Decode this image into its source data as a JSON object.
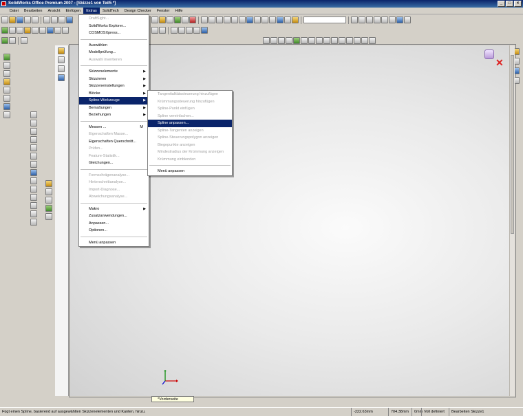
{
  "window": {
    "title": "SolidWorks Office Premium 2007 - [Skizze1 von Teil5 *]",
    "controls": [
      "_",
      "□",
      "×"
    ]
  },
  "menubar": {
    "items": [
      "Datei",
      "Bearbeiten",
      "Ansicht",
      "Einfügen",
      "Extras",
      "SolidTech",
      "Design Checker",
      "Fenster",
      "Hilfe"
    ],
    "active": "Extras"
  },
  "extras_menu": {
    "items": [
      {
        "label": "DraftSight...",
        "disabled": true
      },
      {
        "label": "SolidWorks Explorer..."
      },
      {
        "label": "COSMOSXpress..."
      },
      {
        "sep": true
      },
      {
        "label": "Auswählen"
      },
      {
        "label": "Modellprüfung..."
      },
      {
        "label": "Auswahl invertieren",
        "disabled": true
      },
      {
        "sep": true
      },
      {
        "label": "Skizzenelemente",
        "submenu": true
      },
      {
        "label": "Skizzieren",
        "submenu": true
      },
      {
        "label": "Skizzeneinstellungen",
        "submenu": true
      },
      {
        "label": "Blöcke",
        "submenu": true
      },
      {
        "label": "Spline-Werkzeuge",
        "submenu": true,
        "highlighted": true
      },
      {
        "label": "Bemaßungen",
        "submenu": true
      },
      {
        "label": "Beziehungen",
        "submenu": true
      },
      {
        "sep": true
      },
      {
        "label": "Messen ...",
        "shortcut": "M"
      },
      {
        "label": "Eigenschaften Masse...",
        "disabled": true
      },
      {
        "label": "Eigenschaften Querschnitt..."
      },
      {
        "label": "Prüfen...",
        "disabled": true
      },
      {
        "label": "Feature-Statistik...",
        "disabled": true
      },
      {
        "label": "Gleichungen..."
      },
      {
        "sep": true
      },
      {
        "label": "Formschrägenanalyse...",
        "disabled": true
      },
      {
        "label": "Hinterschnittanalyse...",
        "disabled": true
      },
      {
        "label": "Import-Diagnose...",
        "disabled": true
      },
      {
        "label": "Abweichungsanalyse...",
        "disabled": true
      },
      {
        "sep": true
      },
      {
        "label": "Makro",
        "submenu": true
      },
      {
        "label": "Zusatzanwendungen..."
      },
      {
        "label": "Anpassen..."
      },
      {
        "label": "Optionen..."
      },
      {
        "sep": true
      },
      {
        "label": "Menü anpassen"
      }
    ]
  },
  "spline_submenu": {
    "items": [
      {
        "label": "Tangentialitätssteuerung hinzufügen",
        "disabled": true
      },
      {
        "label": "Krümmungssteuerung hinzufügen",
        "disabled": true
      },
      {
        "label": "Spline-Punkt einfügen",
        "disabled": true
      },
      {
        "label": "Spline vereinfachen...",
        "disabled": true
      },
      {
        "label": "Spline anpassen...",
        "highlighted": true
      },
      {
        "label": "Spline-Tangenten anzeigen",
        "disabled": true
      },
      {
        "label": "Spline-Steuerungspolygon anzeigen",
        "disabled": true
      },
      {
        "label": "Biegepunkte anzeigen",
        "disabled": true
      },
      {
        "label": "Mindestradius der Krümmung anzeigen",
        "disabled": true
      },
      {
        "label": "Krümmung einblenden",
        "disabled": true
      },
      {
        "sep": true
      },
      {
        "label": "Menü anpassen"
      }
    ]
  },
  "viewport": {
    "view_tab": "*Vorderseite"
  },
  "statusbar": {
    "message": "Fügt einen Spline, basierend auf ausgewählten Skizzenelementen und Kanten, hinzu.",
    "x": "-222.63mm",
    "y": "704.38mm",
    "z": "0mm",
    "state": "Voll definiert",
    "mode": "Bearbeiten Skizze1"
  },
  "colors": {
    "titlebar": "#0a246a",
    "highlight": "#0a246a",
    "chrome": "#d4d0c8"
  }
}
